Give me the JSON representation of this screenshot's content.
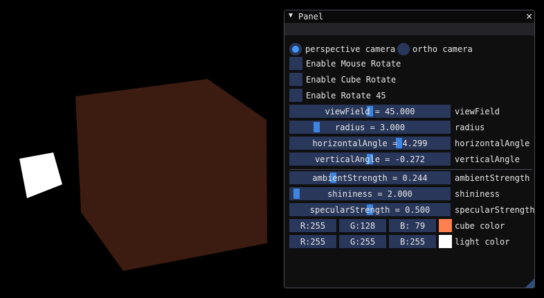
{
  "panel": {
    "title": "Panel",
    "camera": {
      "perspective_label": "perspective camera",
      "ortho_label": "ortho camera",
      "selected": "perspective"
    },
    "checkboxes": [
      {
        "label": "Enable Mouse Rotate",
        "checked": false
      },
      {
        "label": "Enable Cube Rotate",
        "checked": false
      },
      {
        "label": "Enable Rotate 45",
        "checked": false
      }
    ],
    "sliders": [
      {
        "text": "viewField = 45.000",
        "label": "viewField",
        "value": 45.0,
        "fraction": 0.5
      },
      {
        "text": "radius = 3.000",
        "label": "radius",
        "value": 3.0,
        "fraction": 0.15
      },
      {
        "text": "horizontalAngle = 4.299",
        "label": "horizontalAngle",
        "value": 4.299,
        "fraction": 0.69
      },
      {
        "text": "verticalAngle = -0.272",
        "label": "verticalAngle",
        "value": -0.272,
        "fraction": 0.5
      },
      {
        "text": "ambientStrength = 0.244",
        "label": "ambientStrength",
        "value": 0.244,
        "fraction": 0.26
      },
      {
        "text": "shininess = 2.000",
        "label": "shininess",
        "value": 2.0,
        "fraction": 0.02
      },
      {
        "text": "specularStrength = 0.500",
        "label": "specularStrength",
        "value": 0.5,
        "fraction": 0.5
      }
    ],
    "colors": [
      {
        "r": "R:255",
        "g": "G:128",
        "b": "B: 79",
        "label": "cube color",
        "swatch": "#ff804f"
      },
      {
        "r": "R:255",
        "g": "G:255",
        "b": "B:255",
        "label": "light color",
        "swatch": "#ffffff"
      }
    ]
  },
  "scene": {
    "cube_color": "#3c1b10",
    "light_cube_color": "#ffffff",
    "background": "#000000"
  }
}
